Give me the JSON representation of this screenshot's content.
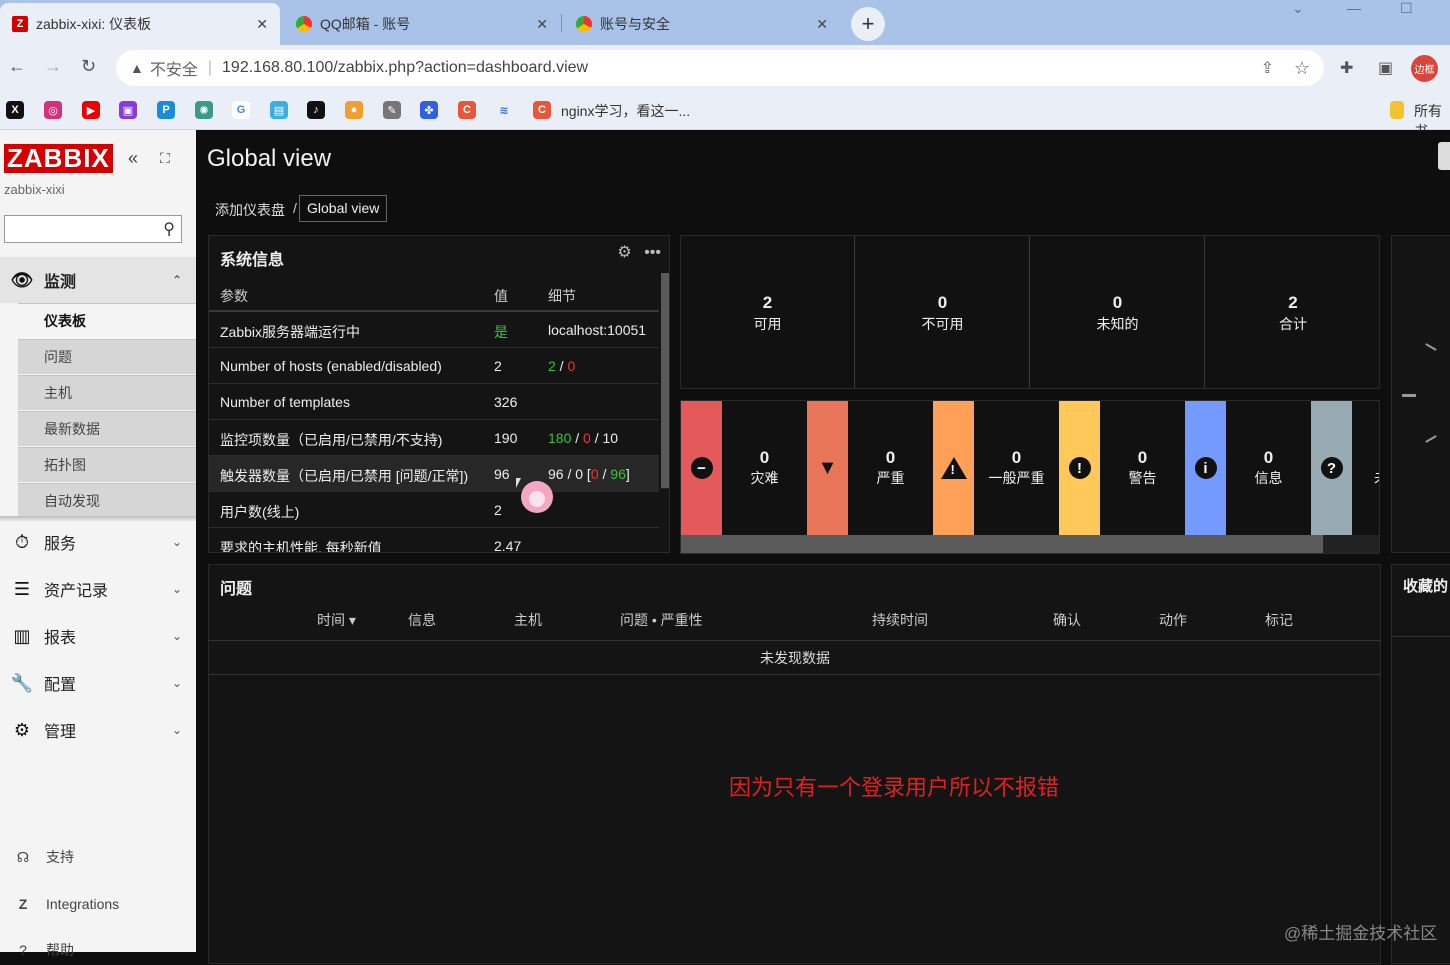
{
  "browser": {
    "tabs": [
      {
        "title": "zabbix-xixi: 仪表板",
        "icon": "Z"
      },
      {
        "title": "QQ邮箱 - 账号",
        "icon": ""
      },
      {
        "title": "账号与安全",
        "icon": ""
      }
    ],
    "insecure_label": "不安全",
    "url": "192.168.80.100/zabbix.php?action=dashboard.view",
    "avatar_text": "边框",
    "bookmark_text": "nginx学习，看这一...",
    "bookmark_folder": "所有书"
  },
  "sidebar": {
    "logo": "ZABBIX",
    "server_name": "zabbix-xixi",
    "menu": [
      {
        "label": "监测",
        "icon": "eye-icon"
      },
      {
        "label": "服务",
        "icon": "clock-icon"
      },
      {
        "label": "资产记录",
        "icon": "list-icon"
      },
      {
        "label": "报表",
        "icon": "chart-icon"
      },
      {
        "label": "配置",
        "icon": "wrench-icon"
      },
      {
        "label": "管理",
        "icon": "gear-icon"
      }
    ],
    "submenu": [
      "仪表板",
      "问题",
      "主机",
      "最新数据",
      "拓扑图",
      "自动发现"
    ],
    "footer": [
      "支持",
      "Integrations",
      "帮助"
    ]
  },
  "main": {
    "title": "Global view",
    "breadcrumb": [
      "添加仪表盘",
      "/",
      "Global view"
    ]
  },
  "system_info": {
    "title": "系统信息",
    "headers": [
      "参数",
      "值",
      "细节"
    ],
    "rows": [
      {
        "param": "Zabbix服务器端运行中",
        "value": "是",
        "detail": "localhost:10051"
      },
      {
        "param": "Number of hosts (enabled/disabled)",
        "value": "2",
        "d1": "2",
        "d2": " / ",
        "d3": "0"
      },
      {
        "param": "Number of templates",
        "value": "326",
        "detail": ""
      },
      {
        "param": "监控项数量（已启用/已禁用/不支持)",
        "value": "190",
        "d1": "180",
        "d2": " / ",
        "d3": "0",
        "d4": " / 10"
      },
      {
        "param": "触发器数量（已启用/已禁用 [问题/正常])",
        "value": "96",
        "d1": "96 / 0 [",
        "d2": "0",
        "d3": " / ",
        "d4": "96",
        "d5": "]"
      },
      {
        "param": "用户数(线上)",
        "value": "2",
        "detail": ""
      },
      {
        "param": "要求的主机性能, 每秒新值",
        "value": "2.47",
        "detail": ""
      }
    ]
  },
  "host_availability": [
    {
      "n": "2",
      "label": "可用"
    },
    {
      "n": "0",
      "label": "不可用"
    },
    {
      "n": "0",
      "label": "未知的"
    },
    {
      "n": "2",
      "label": "合计"
    }
  ],
  "severity": [
    {
      "n": "0",
      "label": "灾难",
      "color": "#e45959",
      "icon": "minus-icon"
    },
    {
      "n": "0",
      "label": "严重",
      "color": "#e97659",
      "icon": "warning-icon"
    },
    {
      "n": "0",
      "label": "一般严重",
      "color": "#ffa059",
      "icon": "triangle-icon"
    },
    {
      "n": "0",
      "label": "警告",
      "color": "#ffc859",
      "icon": "exclamation-icon"
    },
    {
      "n": "0",
      "label": "信息",
      "color": "#7499ff",
      "icon": "info-icon"
    },
    {
      "n": "",
      "label": "未",
      "color": "#97aab3",
      "icon": "question-icon"
    }
  ],
  "problems": {
    "title": "问题",
    "headers": [
      "时间 ▾",
      "信息",
      "主机",
      "问题 • 严重性",
      "持续时间",
      "确认",
      "动作",
      "标记"
    ],
    "empty": "未发现数据"
  },
  "favorites_title": "收藏的",
  "annotation": "因为只有一个登录用户所以不报错",
  "watermark": "@稀土掘金技术社区"
}
